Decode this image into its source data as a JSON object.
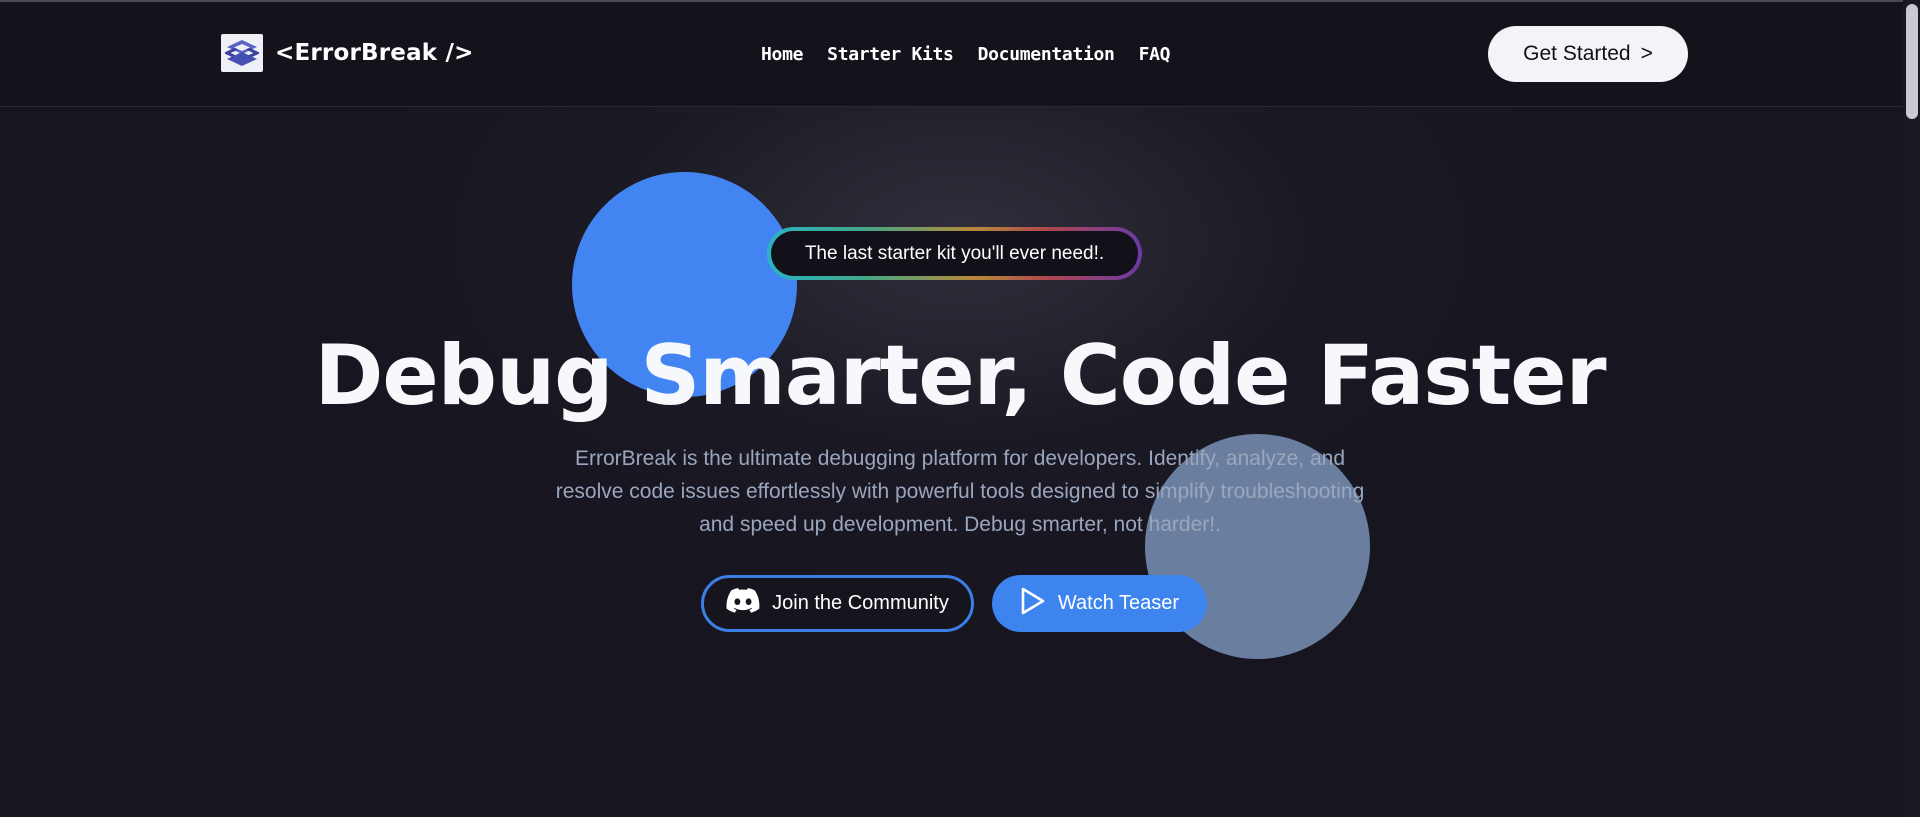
{
  "header": {
    "logo_text": "<ErrorBreak />",
    "nav": [
      {
        "label": "Home"
      },
      {
        "label": "Starter Kits"
      },
      {
        "label": "Documentation"
      },
      {
        "label": "FAQ"
      }
    ],
    "cta_label": "Get Started",
    "cta_arrow": ">"
  },
  "hero": {
    "badge_text": "The last starter kit you'll ever need!.",
    "title": "Debug Smarter, Code Faster",
    "description": "ErrorBreak is the ultimate debugging platform for developers. Identify, analyze, and resolve code issues effortlessly with powerful tools designed to simplify troubleshooting and speed up development. Debug smarter, not harder!.",
    "primary_button": {
      "label": "Join the Community",
      "icon": "discord-icon"
    },
    "secondary_button": {
      "label": "Watch Teaser",
      "icon": "play-icon"
    }
  },
  "colors": {
    "background": "#17151f",
    "accent_blue": "#3d84ef",
    "circle_blue": "#4285f2",
    "circle_slate": "#6a7f9f",
    "text_muted": "#9aa6bd"
  }
}
